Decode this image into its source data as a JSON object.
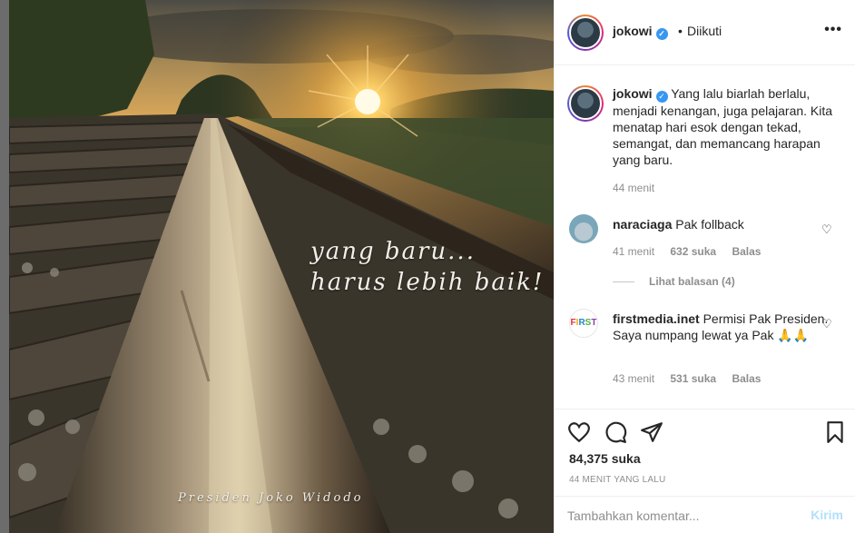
{
  "post": {
    "overlay_line1": "yang baru...",
    "overlay_line2": "harus lebih baik!",
    "signature": "Presiden Joko Widodo"
  },
  "header": {
    "username": "jokowi",
    "verified_icon": "verified-badge-icon",
    "separator": "•",
    "follow_status": "Diikuti",
    "more_icon": "more-options-icon"
  },
  "caption": {
    "username": "jokowi",
    "text": "Yang lalu biarlah berlalu, menjadi kenangan, juga pelajaran. Kita menatap hari esok dengan tekad, semangat, dan memancang harapan yang baru.",
    "time": "44 menit"
  },
  "comments": [
    {
      "username": "naraciaga",
      "text": "Pak follback",
      "time": "41 menit",
      "likes": "632 suka",
      "reply": "Balas",
      "view_replies": "Lihat balasan (4)"
    },
    {
      "username": "firstmedia.inet",
      "text": "Permisi Pak Presiden. Saya numpang lewat ya Pak 🙏🙏",
      "time": "43 menit",
      "likes": "531 suka",
      "reply": "Balas"
    }
  ],
  "actions": {
    "like_icon": "heart-icon",
    "comment_icon": "comment-icon",
    "share_icon": "share-icon",
    "save_icon": "bookmark-icon",
    "likes_count": "84,375 suka",
    "posted_ago": "44 MENIT YANG LALU"
  },
  "add_comment": {
    "placeholder": "Tambahkan komentar...",
    "post_label": "Kirim"
  },
  "colors": {
    "accent": "#3897f0",
    "post_disabled": "#b2dffc",
    "muted": "#8e8e8e"
  }
}
